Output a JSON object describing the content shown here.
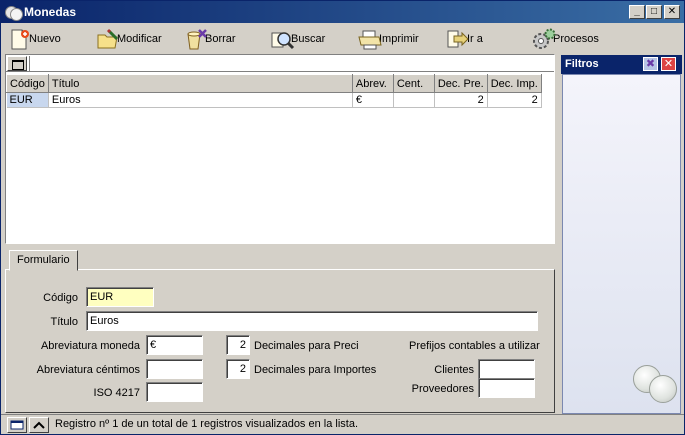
{
  "window": {
    "title": "Monedas",
    "controls": {
      "minimize": "_",
      "maximize": "□",
      "close": "✕"
    }
  },
  "toolbar": {
    "items": [
      {
        "label": "Nuevo",
        "icon": "new-document-icon"
      },
      {
        "label": "Modificar",
        "icon": "edit-folder-icon"
      },
      {
        "label": "Borrar",
        "icon": "delete-trash-icon"
      },
      {
        "label": "Buscar",
        "icon": "search-magnifier-icon"
      },
      {
        "label": "Imprimir",
        "icon": "printer-icon"
      },
      {
        "label": "Ir a",
        "icon": "go-to-icon"
      },
      {
        "label": "Procesos",
        "icon": "gears-icon"
      }
    ]
  },
  "grid": {
    "columns": [
      "Código",
      "Título",
      "Abrev.",
      "Cent.",
      "Dec. Pre.",
      "Dec. Imp."
    ],
    "rows": [
      {
        "codigo": "EUR",
        "titulo": "Euros",
        "abrev": "€",
        "cent": "",
        "dec_pre": "2",
        "dec_imp": "2"
      }
    ]
  },
  "filtros": {
    "title": "Filtros",
    "pin_label": "✖",
    "close_label": "✕"
  },
  "form": {
    "tab_label": "Formulario",
    "codigo": {
      "label": "Código",
      "value": "EUR"
    },
    "titulo": {
      "label": "Título",
      "value": "Euros"
    },
    "abrev_moneda": {
      "label": "Abreviatura moneda",
      "value": "€"
    },
    "abrev_centimos": {
      "label": "Abreviatura céntimos",
      "value": ""
    },
    "iso": {
      "label": "ISO 4217",
      "value": ""
    },
    "dec_precios": {
      "label": "Decimales para Preci",
      "value": "2"
    },
    "dec_importes": {
      "label": "Decimales para Importes",
      "value": "2"
    },
    "prefijos": {
      "label": "Prefijos contables a utilizar"
    },
    "clientes": {
      "label": "Clientes",
      "value": ""
    },
    "proveedores": {
      "label": "Proveedores",
      "value": ""
    }
  },
  "status": {
    "text": "Registro nº 1 de un total de 1 registros visualizados en la lista."
  }
}
